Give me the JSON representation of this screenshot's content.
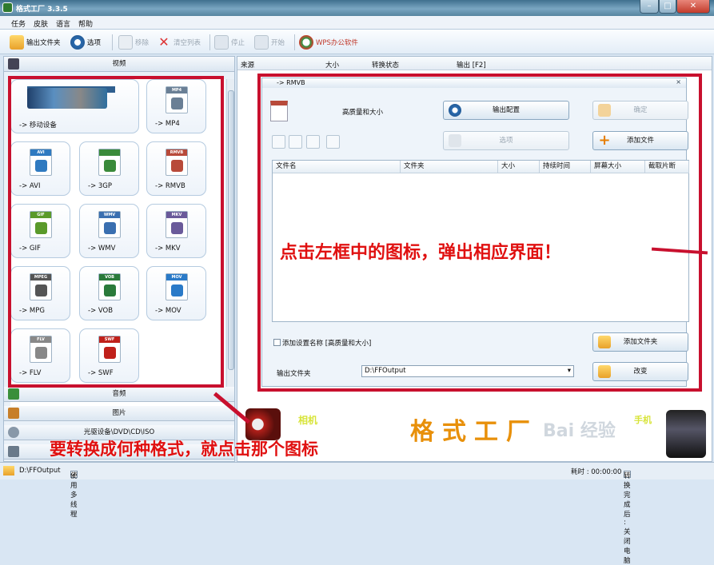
{
  "window": {
    "title": "格式工厂 3.3.5"
  },
  "menu": [
    "任务",
    "皮肤",
    "语言",
    "帮助"
  ],
  "toolbar": {
    "output_folder": "输出文件夹",
    "options": "选项",
    "remove": "移除",
    "clear_list": "清空列表",
    "stop": "停止",
    "start": "开始",
    "wps": "WPS办公软件"
  },
  "left": {
    "video_header": "视频",
    "audio_header": "音频",
    "image_header": "图片",
    "disc_header": "光驱设备\\DVD\\CD\\ISO",
    "tiles": [
      {
        "label": "-> 移动设备",
        "badge": ""
      },
      {
        "label": "-> MP4",
        "badge": "MP4"
      },
      {
        "label": "-> AVI",
        "badge": "AVI"
      },
      {
        "label": "-> 3GP",
        "badge": ""
      },
      {
        "label": "-> RMVB",
        "badge": "RMVB"
      },
      {
        "label": "-> GIF",
        "badge": "GIF"
      },
      {
        "label": "-> WMV",
        "badge": "WMV"
      },
      {
        "label": "-> MKV",
        "badge": "MKV"
      },
      {
        "label": "-> MPG",
        "badge": "MPEG"
      },
      {
        "label": "-> VOB",
        "badge": "VOB"
      },
      {
        "label": "-> MOV",
        "badge": "MOV"
      },
      {
        "label": "-> FLV",
        "badge": "FLV"
      },
      {
        "label": "-> SWF",
        "badge": "SWF"
      }
    ]
  },
  "list_header": {
    "source": "来源",
    "size": "大小",
    "status": "转换状态",
    "output": "输出 [F2]"
  },
  "dialog": {
    "title": "-> RMVB",
    "quality": "高质量和大小",
    "output_config": "输出配置",
    "ok": "确定",
    "options": "选项",
    "add_file": "添加文件",
    "columns": [
      "文件名",
      "文件夹",
      "大小",
      "持续时间",
      "屏幕大小",
      "截取片断"
    ],
    "add_setting_name": "添加设置名称 [高质量和大小]",
    "add_folder": "添加文件夹",
    "output_folder_label": "输出文件夹",
    "output_folder_value": "D:\\FFOutput",
    "change": "改变"
  },
  "annotations": {
    "callout": "点击左框中的图标，弹出相应界面！",
    "bottom": "要转换成何种格式，就点击那个图标",
    "camera_label": "相机",
    "phone_label": "手机",
    "brand": "格式工厂"
  },
  "watermark": "Bai 经验",
  "status": {
    "path": "D:\\FFOutput",
    "multithread": "使用多线程",
    "elapsed": "耗时 : 00:00:00",
    "after_done": "转换完成后 : 关闭电脑"
  },
  "colors": {
    "accent_red": "#c8102e",
    "callout_red": "#e01010"
  }
}
